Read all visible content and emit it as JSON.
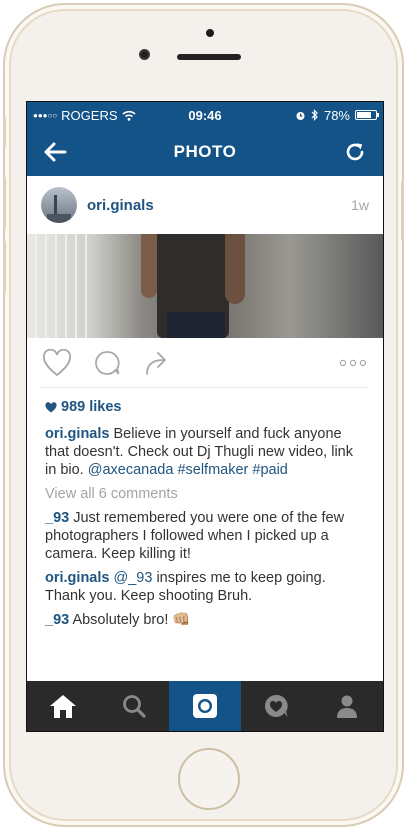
{
  "status_bar": {
    "carrier": "ROGERS",
    "time": "09:46",
    "battery": "78%",
    "battery_level": 0.78
  },
  "nav": {
    "title": "PHOTO",
    "back_icon": "back-arrow-icon",
    "refresh_icon": "refresh-icon"
  },
  "post": {
    "username": "ori.ginals",
    "age": "1w",
    "likes": "989 likes",
    "caption": {
      "username": "ori.ginals",
      "text": "Believe in yourself and fuck anyone that doesn't. Check out Dj Thugli new video, link in bio.",
      "mention": "@axecanada",
      "hashtags": "#selfmaker #paid"
    },
    "view_all": "View all 6 comments",
    "comments": [
      {
        "username": "_93",
        "text": "Just remembered you were one of the few photographers I followed when I picked up a camera. Keep killing it!"
      },
      {
        "username": "ori.ginals",
        "mention": "@_93",
        "text": "inspires me to keep going. Thank you. Keep shooting Bruh."
      },
      {
        "username": "_93",
        "text": "Absolutely bro! 👊🏼"
      }
    ]
  },
  "tabs": [
    "home",
    "search",
    "camera",
    "activity",
    "profile"
  ],
  "colors": {
    "brand": "#135387",
    "link": "#1f5580",
    "tabbar": "#2a2a2a"
  }
}
